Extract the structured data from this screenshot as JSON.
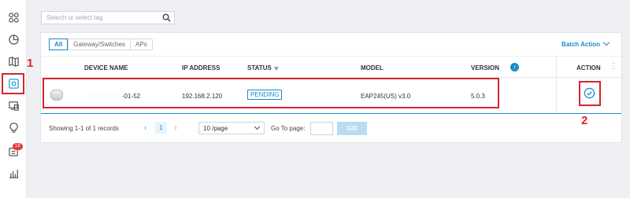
{
  "sidebar": {
    "items": [
      {
        "icon": "dashboard-icon"
      },
      {
        "icon": "statistics-icon"
      },
      {
        "icon": "map-icon"
      },
      {
        "icon": "devices-icon",
        "active": true
      },
      {
        "icon": "clients-icon"
      },
      {
        "icon": "insight-icon"
      },
      {
        "icon": "logs-icon",
        "badge": "18"
      },
      {
        "icon": "reports-icon"
      }
    ]
  },
  "search": {
    "placeholder": "Search or select tag"
  },
  "tabs": [
    {
      "label": "All",
      "active": true
    },
    {
      "label": "Gateway/Switches"
    },
    {
      "label": "APs"
    }
  ],
  "batch_action": "Batch Action",
  "table": {
    "headers": {
      "device_name": "DEVICE NAME",
      "ip_address": "IP ADDRESS",
      "status": "STATUS",
      "model": "MODEL",
      "version": "VERSION",
      "action": "ACTION"
    },
    "rows": [
      {
        "device_name": "-01-52",
        "ip_address": "192.168.2.120",
        "status": "PENDING",
        "model": "EAP245(US) v3.0",
        "version": "5.0.3"
      }
    ]
  },
  "pagination": {
    "summary": "Showing 1-1 of 1 records",
    "current_page": "1",
    "page_size": "10 /page",
    "goto_label": "Go To page:",
    "go_button": "GO"
  },
  "annotations": {
    "one": "1",
    "two": "2"
  },
  "colors": {
    "accent": "#1a8cc8",
    "highlight": "#d6252f",
    "badge": "#e5393a"
  }
}
